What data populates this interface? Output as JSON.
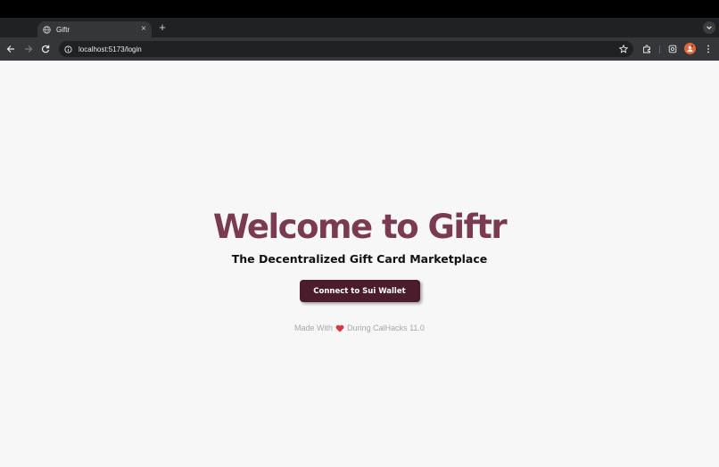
{
  "browser": {
    "tab": {
      "title": "Giftr",
      "favicon": "globe-icon",
      "close_glyph": "×"
    },
    "new_tab_glyph": "+",
    "url": "localhost:5173/login",
    "icons": [
      "back-icon",
      "forward-icon",
      "reload-icon",
      "site-info-icon",
      "bookmark-star-icon",
      "extensions-icon",
      "media-icon",
      "profile-avatar",
      "menu-icon",
      "tab-search-icon"
    ]
  },
  "page": {
    "heading": "Welcome to Giftr",
    "subtitle": "The Decentralized Gift Card Marketplace",
    "connect_button": "Connect to Sui Wallet",
    "footer_prefix": "Made With",
    "footer_icon": "heart-icon",
    "footer_suffix": "During CalHacks 11.0"
  },
  "colors": {
    "heading": "#7a3b52",
    "button_bg": "#4b1d2c",
    "heart": "#d9383f",
    "page_bg": "#f7f7f7"
  }
}
